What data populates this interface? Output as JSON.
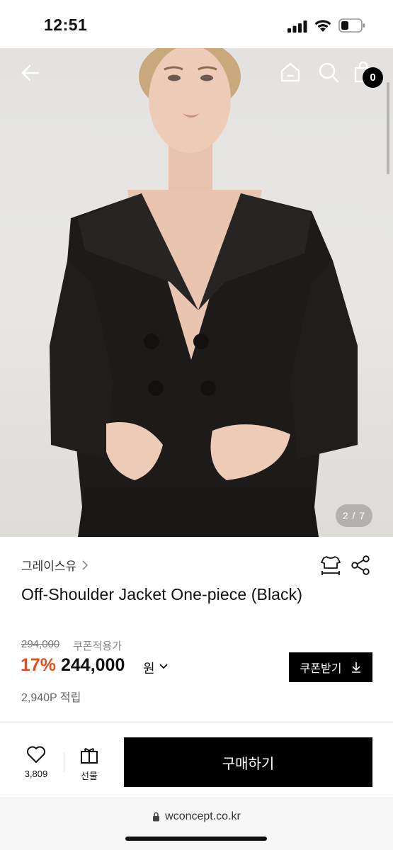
{
  "status_bar": {
    "time": "12:51"
  },
  "header": {
    "cart_count": "0"
  },
  "gallery": {
    "page_indicator": "2 / 7"
  },
  "product": {
    "brand": "그레이스유",
    "title": "Off-Shoulder Jacket One-piece (Black)",
    "original_price": "294,000",
    "coupon_note": "쿠폰적용가",
    "discount": "17%",
    "price": "244,000",
    "currency": "원",
    "points": "2,940P 적립",
    "coupon_button": "쿠폰받기"
  },
  "actions": {
    "wish_count": "3,809",
    "gift_label": "선물",
    "buy_label": "구매하기"
  },
  "browser": {
    "url": "wconcept.co.kr"
  },
  "colors": {
    "accent_discount": "#e24e1b",
    "button_bg": "#000000"
  },
  "icons": [
    "back-arrow-icon",
    "home-icon",
    "search-icon",
    "shopping-bag-icon",
    "size-guide-icon",
    "share-icon",
    "heart-icon",
    "gift-icon",
    "download-icon",
    "lock-icon"
  ]
}
